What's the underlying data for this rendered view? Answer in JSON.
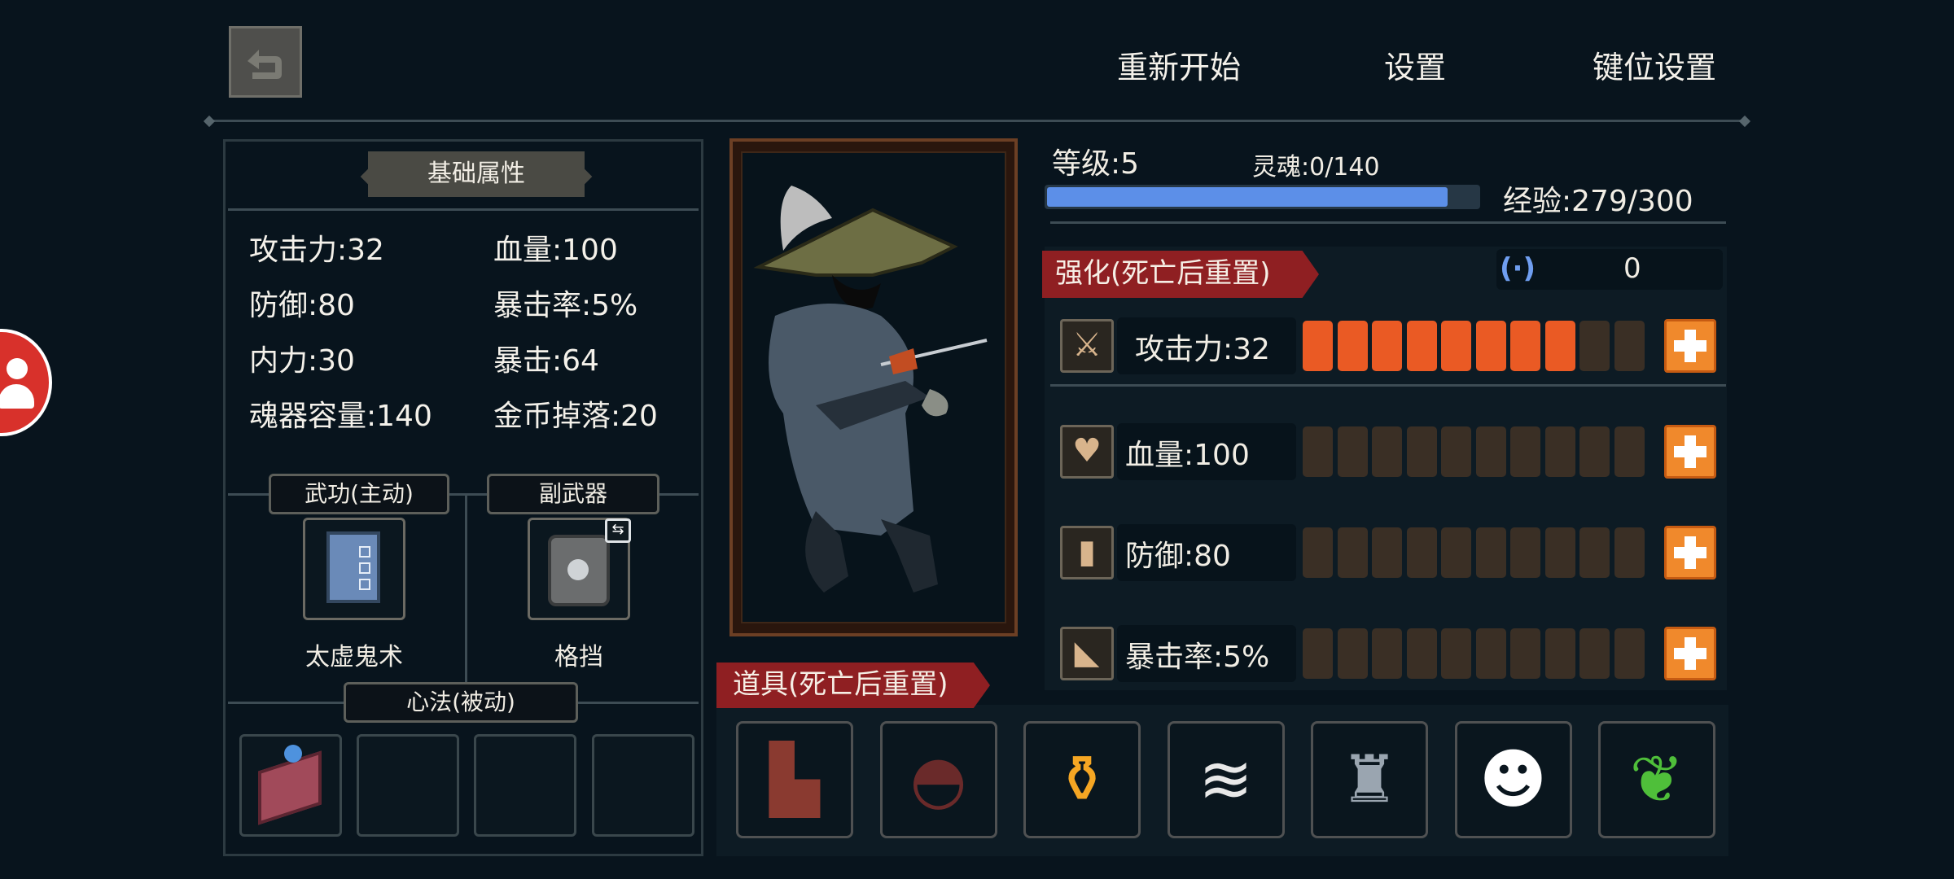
{
  "top_menu": {
    "restart": "重新开始",
    "settings": "设置",
    "key_settings": "键位设置"
  },
  "left_panel": {
    "title": "基础属性",
    "stats": [
      {
        "text": "攻击力:32"
      },
      {
        "text": "血量:100"
      },
      {
        "text": "防御:80"
      },
      {
        "text": "暴击率:5%"
      },
      {
        "text": "内力:30"
      },
      {
        "text": "暴击:64"
      },
      {
        "text": "魂器容量:140"
      },
      {
        "text": "金币掉落:20"
      }
    ],
    "martial_tag": "武功(主动)",
    "secondary_tag": "副武器",
    "martial_skill": "太虚鬼术",
    "secondary_weapon": "格挡",
    "mind_tag": "心法(被动)"
  },
  "progress": {
    "level": "等级:5",
    "soul": "灵魂:0/140",
    "exp": "经验:279/300",
    "exp_value": 279,
    "exp_max": 300
  },
  "upgrade": {
    "title": "强化(死亡后重置)",
    "currency_value": "0",
    "rows": [
      {
        "label": "攻击力:32",
        "icon": "sword-icon",
        "filled": 8,
        "total": 10
      },
      {
        "label": "血量:100",
        "icon": "heart-icon",
        "filled": 0,
        "total": 10
      },
      {
        "label": "防御:80",
        "icon": "shield-icon",
        "filled": 0,
        "total": 10
      },
      {
        "label": "暴击率:5%",
        "icon": "crit-icon",
        "filled": 0,
        "total": 10
      }
    ]
  },
  "items": {
    "title": "道具(死亡后重置)",
    "slots": [
      {
        "icon": "boots-icon"
      },
      {
        "icon": "helmet-icon"
      },
      {
        "icon": "potion-icon"
      },
      {
        "icon": "fishbone-icon"
      },
      {
        "icon": "armor-icon"
      },
      {
        "icon": "demon-mask-icon"
      },
      {
        "icon": "herb-icon"
      }
    ]
  },
  "colors": {
    "background": "#08141d",
    "upgrade_on": "#ea5a24",
    "upgrade_off": "#3a2f25",
    "plus_button": "#f0892c",
    "exp_bar": "#5c8fe8",
    "section_red": "#8f1f22"
  }
}
